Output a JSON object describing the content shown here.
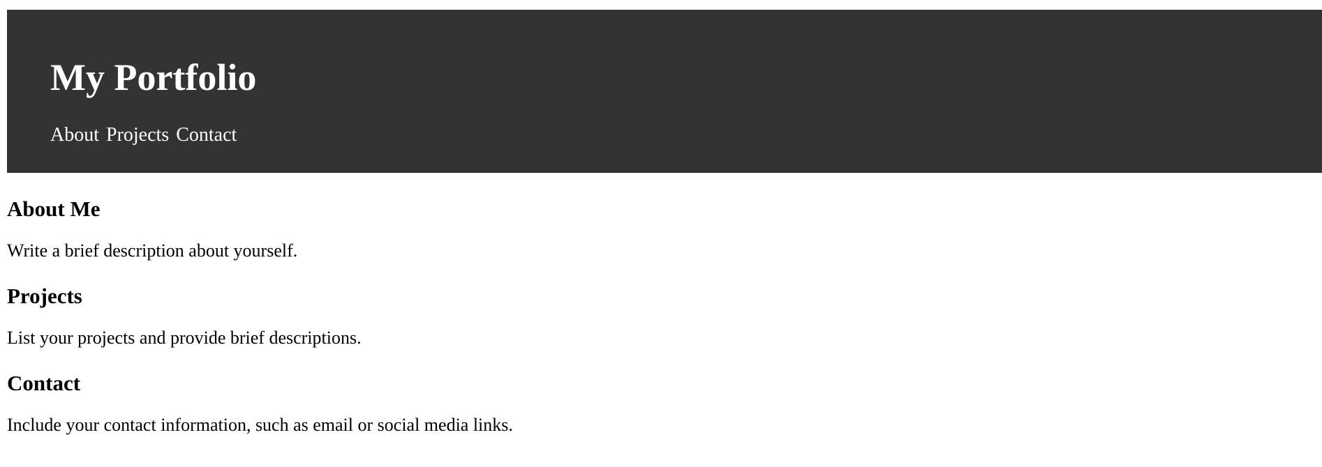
{
  "header": {
    "title": "My Portfolio",
    "nav": [
      {
        "label": "About"
      },
      {
        "label": "Projects"
      },
      {
        "label": "Contact"
      }
    ],
    "background_color": "#333333",
    "text_color": "#ffffff"
  },
  "sections": [
    {
      "heading": "About Me",
      "text": "Write a brief description about yourself."
    },
    {
      "heading": "Projects",
      "text": "List your projects and provide brief descriptions."
    },
    {
      "heading": "Contact",
      "text": "Include your contact information, such as email or social media links."
    }
  ]
}
